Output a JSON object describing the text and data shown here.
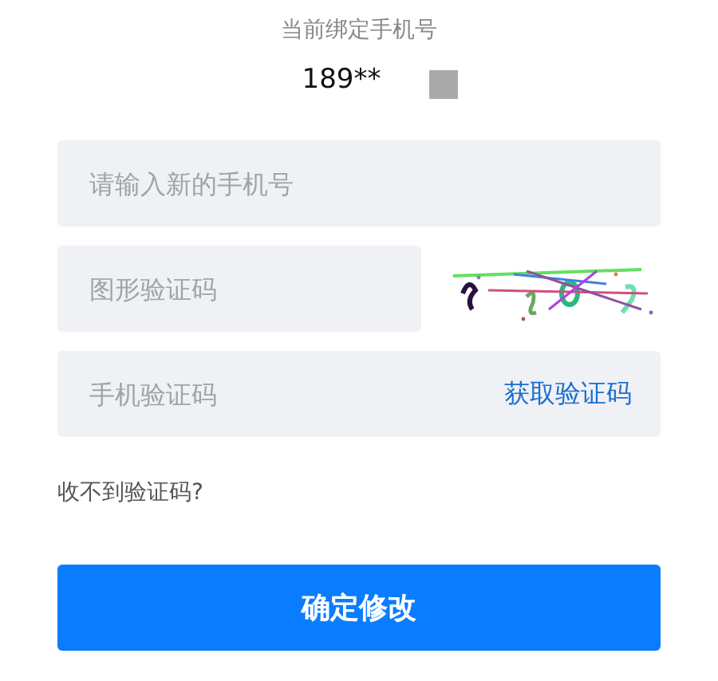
{
  "header": {
    "label": "当前绑定手机号",
    "phone": "189**"
  },
  "fields": [
    {
      "kind": "plain",
      "placeholder": "请输入新的手机号"
    },
    {
      "kind": "captcha",
      "placeholder": "图形验证码"
    },
    {
      "kind": "sms",
      "placeholder": "手机验证码",
      "action": "获取验证码"
    }
  ],
  "help_link": "收不到验证码?",
  "submit": "确定修改"
}
